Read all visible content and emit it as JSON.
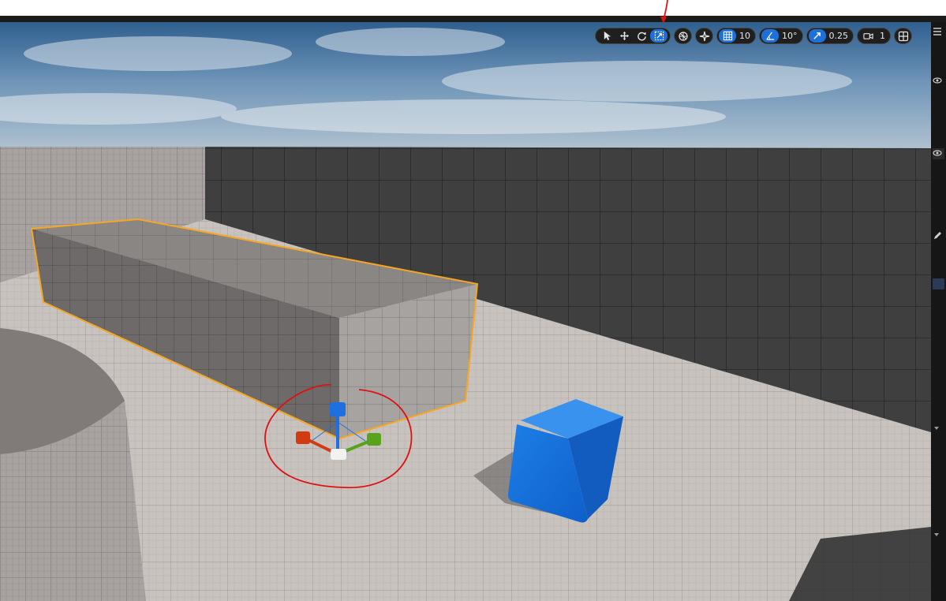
{
  "toolbar": {
    "transform_modes": [
      {
        "name": "select-icon",
        "active": false
      },
      {
        "name": "move-icon",
        "active": false
      },
      {
        "name": "rotate-icon",
        "active": false
      },
      {
        "name": "scale-icon",
        "active": true
      }
    ],
    "world_local_icon": "globe-icon",
    "surface_snap_icon": "surface-snap-icon",
    "grid_snap_value": "10",
    "rotation_snap_value": "10°",
    "scale_snap_value": "0.25",
    "camera_speed_value": "1",
    "viewport_layout_icon": "layout-grid-icon"
  },
  "colors": {
    "accent": "#1f6fd8",
    "selection_outline": "#f5a623",
    "annotation": "#e01010",
    "gizmo_x": "#d23a12",
    "gizmo_y": "#58a31c",
    "gizmo_z": "#1e6fe0",
    "blue_cube": "#1a73e0"
  }
}
